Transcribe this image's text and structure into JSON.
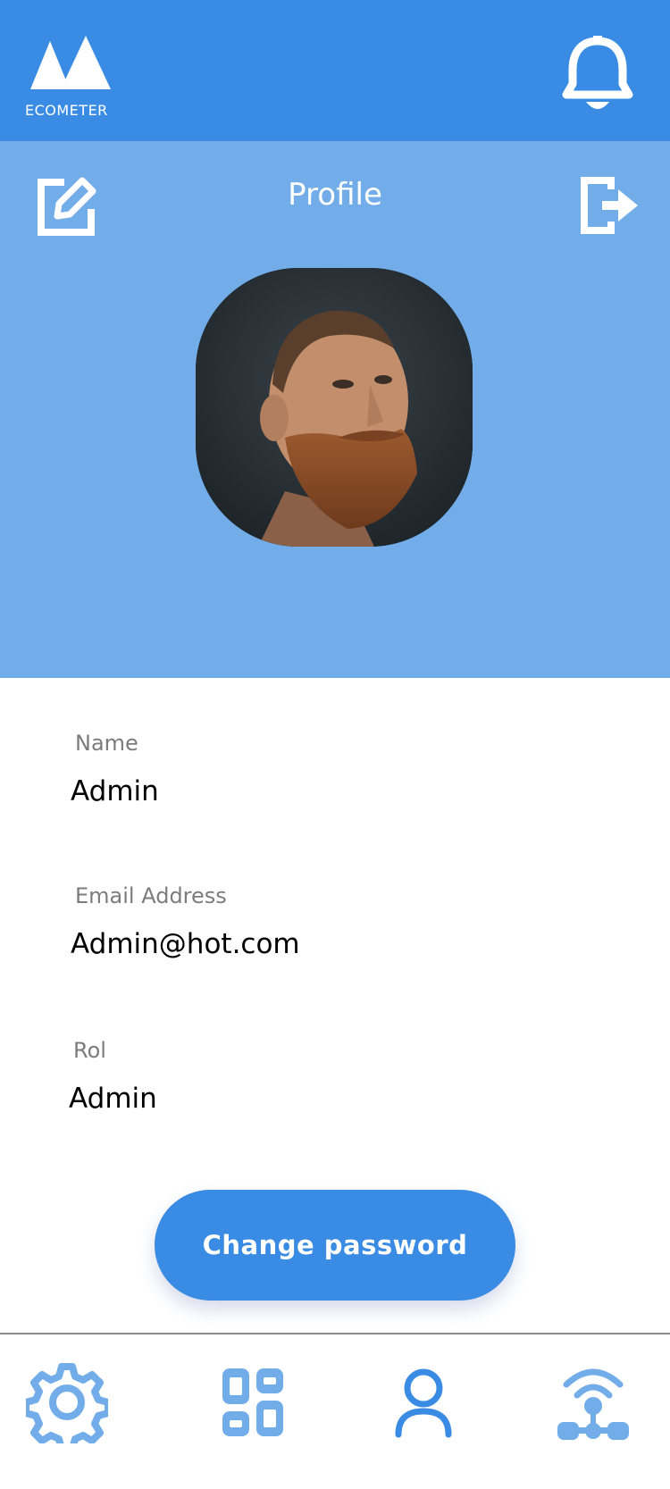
{
  "app": {
    "brand": "ECOMETER",
    "accent_color": "#3a8be3",
    "header_color": "#72adea"
  },
  "topbar": {
    "logo_icon": "ecometer-logo",
    "notifications_icon": "bell-icon"
  },
  "profile": {
    "title": "Profile",
    "edit_icon": "edit-icon",
    "logout_icon": "logout-icon",
    "avatar": "user-avatar-photo"
  },
  "fields": [
    {
      "label": "Name",
      "value": "Admin"
    },
    {
      "label": "Email Address",
      "value": "Admin@hot.com"
    },
    {
      "label": "Rol",
      "value": "Admin"
    }
  ],
  "actions": {
    "change_password": "Change password"
  },
  "bottom_nav": {
    "active": "profile",
    "items": [
      {
        "id": "settings",
        "icon": "gear-icon"
      },
      {
        "id": "dashboard",
        "icon": "dashboard-icon"
      },
      {
        "id": "profile",
        "icon": "user-icon"
      },
      {
        "id": "network",
        "icon": "network-icon"
      }
    ]
  }
}
